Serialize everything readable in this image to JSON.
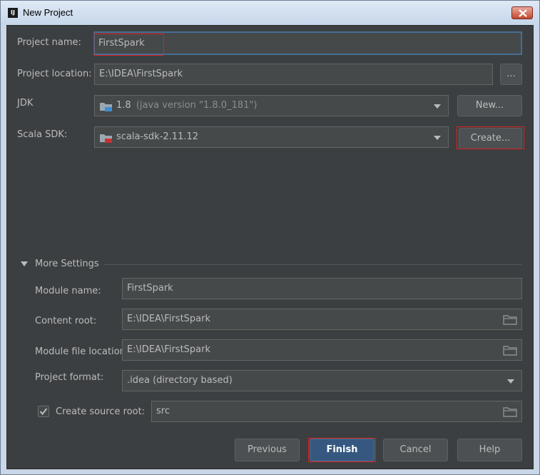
{
  "window": {
    "title": "New Project",
    "app_icon": "IJ"
  },
  "form": {
    "project_name": {
      "label": "Project name:",
      "value": "FirstSpark"
    },
    "project_location": {
      "label": "Project location:",
      "value": "E:\\IDEA\\FirstSpark",
      "browse_label": "..."
    },
    "jdk": {
      "label": "JDK",
      "value": "1.8",
      "detail": "(java version \"1.8.0_181\")",
      "new_label": "New..."
    },
    "scala_sdk": {
      "label": "Scala SDK:",
      "value": "scala-sdk-2.11.12",
      "create_label": "Create..."
    }
  },
  "more_settings": {
    "label": "More Settings",
    "module_name": {
      "label": "Module name:",
      "value": "FirstSpark"
    },
    "content_root": {
      "label": "Content root:",
      "value": "E:\\IDEA\\FirstSpark"
    },
    "module_file_location": {
      "label": "Module file location:",
      "value": "E:\\IDEA\\FirstSpark"
    },
    "project_format": {
      "label": "Project format:",
      "value": ".idea (directory based)"
    },
    "create_source_root": {
      "label": "Create source root:",
      "checked": true,
      "value": "src"
    }
  },
  "buttons": {
    "previous": "Previous",
    "finish": "Finish",
    "cancel": "Cancel",
    "help": "Help"
  },
  "colors": {
    "background": "#3c3f41",
    "field": "#45494a",
    "primary_button": "#365880",
    "highlight": "#e02020"
  },
  "icons": [
    "close-icon",
    "folder-icon",
    "chevron-down-icon",
    "jdk-folder-icon",
    "scala-folder-icon",
    "checkmark-icon",
    "collapse-triangle-icon"
  ]
}
